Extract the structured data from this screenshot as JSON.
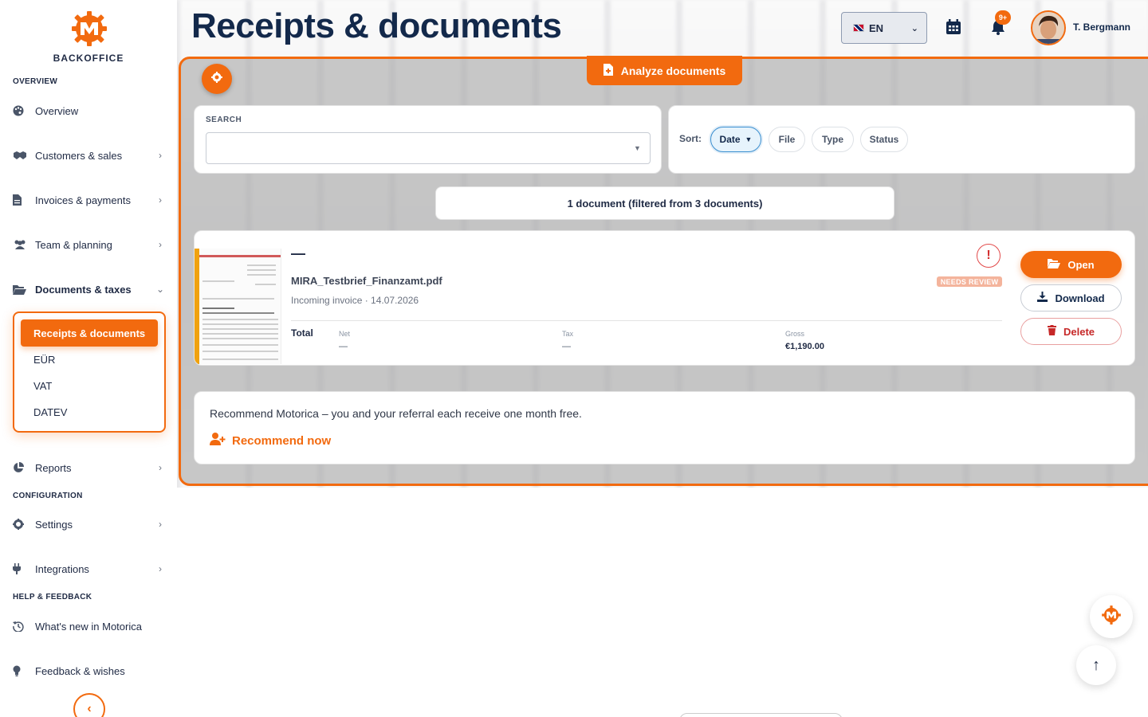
{
  "app": {
    "brand": "BACKOFFICE",
    "page_title": "Receipts & documents"
  },
  "sidebar": {
    "sections": [
      {
        "label": "OVERVIEW"
      },
      {
        "label": "CONFIGURATION"
      },
      {
        "label": "HELP & FEEDBACK"
      }
    ],
    "items": [
      {
        "label": "Overview",
        "icon": "palette-icon"
      },
      {
        "label": "Customers & sales",
        "icon": "handshake-icon"
      },
      {
        "label": "Invoices & payments",
        "icon": "invoice-icon"
      },
      {
        "label": "Team & planning",
        "icon": "users-icon"
      },
      {
        "label": "Documents & taxes",
        "icon": "folder-open-icon"
      },
      {
        "label": "Reports",
        "icon": "pie-chart-icon"
      },
      {
        "label": "Settings",
        "icon": "gear-icon"
      },
      {
        "label": "Integrations",
        "icon": "plug-icon"
      },
      {
        "label": "What's new in Motorica",
        "icon": "history-icon"
      },
      {
        "label": "Feedback & wishes",
        "icon": "lightbulb-icon"
      }
    ],
    "submenu": [
      {
        "label": "Receipts & documents",
        "active": true
      },
      {
        "label": "EÜR"
      },
      {
        "label": "VAT"
      },
      {
        "label": "DATEV"
      }
    ]
  },
  "header": {
    "language": "EN",
    "notification_badge": "9+",
    "user_name": "T. Bergmann"
  },
  "toolbar": {
    "analyze_label": "Analyze documents"
  },
  "search": {
    "label": "SEARCH",
    "value": "",
    "placeholder": ""
  },
  "sort": {
    "label": "Sort:",
    "options": [
      {
        "label": "Date",
        "active": true,
        "direction": "▼"
      },
      {
        "label": "File"
      },
      {
        "label": "Type"
      },
      {
        "label": "Status"
      }
    ]
  },
  "results": {
    "summary": "1 document (filtered from 3 documents)"
  },
  "document": {
    "title": "—",
    "file_name": "MIRA_Testbrief_Finanzamt.pdf",
    "meta": "Incoming invoice · 14.07.2026",
    "status_badge": "NEEDS REVIEW",
    "total_label": "Total",
    "net_label": "Net",
    "net_value": "—",
    "tax_label": "Tax",
    "tax_value": "—",
    "gross_label": "Gross",
    "gross_value": "€1,190.00",
    "actions": {
      "open": "Open",
      "download": "Download",
      "delete": "Delete"
    }
  },
  "recommend": {
    "text": "Recommend Motorica – you and your referral each receive one month free.",
    "link": "Recommend now"
  },
  "colors": {
    "accent": "#f26a0f",
    "navy": "#13294b",
    "danger": "#c62828",
    "review": "#f4b49c"
  }
}
